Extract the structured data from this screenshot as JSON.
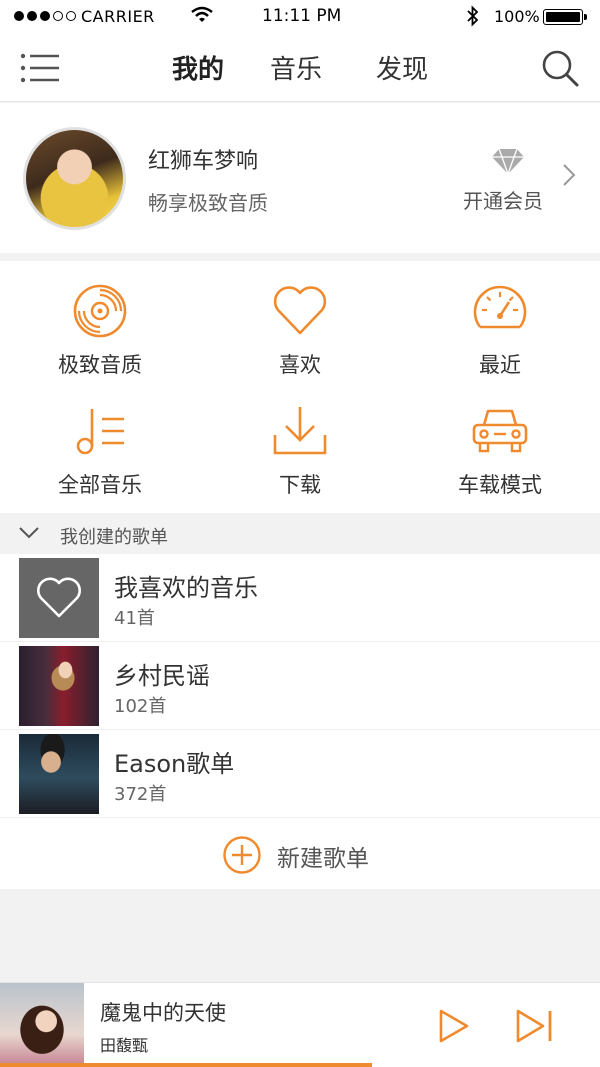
{
  "status_bar": {
    "carrier": "CARRIER",
    "time": "11:11 PM",
    "battery": "100%"
  },
  "nav": {
    "tabs": [
      {
        "label": "我的",
        "active": true
      },
      {
        "label": "音乐",
        "active": false
      },
      {
        "label": "发现",
        "active": false
      }
    ],
    "menu_icon": "menu-icon",
    "search_icon": "search-icon"
  },
  "profile": {
    "name": "红狮车梦响",
    "slogan": "畅享极致音质",
    "vip_label": "开通会员",
    "vip_icon": "diamond-icon"
  },
  "features": [
    {
      "label": "极致音质",
      "icon": "vinyl-icon"
    },
    {
      "label": "喜欢",
      "icon": "heart-icon"
    },
    {
      "label": "最近",
      "icon": "speedometer-icon"
    },
    {
      "label": "全部音乐",
      "icon": "music-list-icon"
    },
    {
      "label": "下载",
      "icon": "download-icon"
    },
    {
      "label": "车载模式",
      "icon": "car-icon"
    }
  ],
  "section": {
    "title": "我创建的歌单"
  },
  "playlists": [
    {
      "name": "我喜欢的音乐",
      "count": "41首"
    },
    {
      "name": "乡村民谣",
      "count": "102首"
    },
    {
      "name": "Eason歌单",
      "count": "372首"
    }
  ],
  "new_playlist_label": "新建歌单",
  "player": {
    "song": "魔鬼中的天使",
    "artist": "田馥甄",
    "progress": 0.62
  },
  "colors": {
    "accent": "#f08a2e",
    "text": "#333333",
    "background": "#f2f2f2"
  }
}
